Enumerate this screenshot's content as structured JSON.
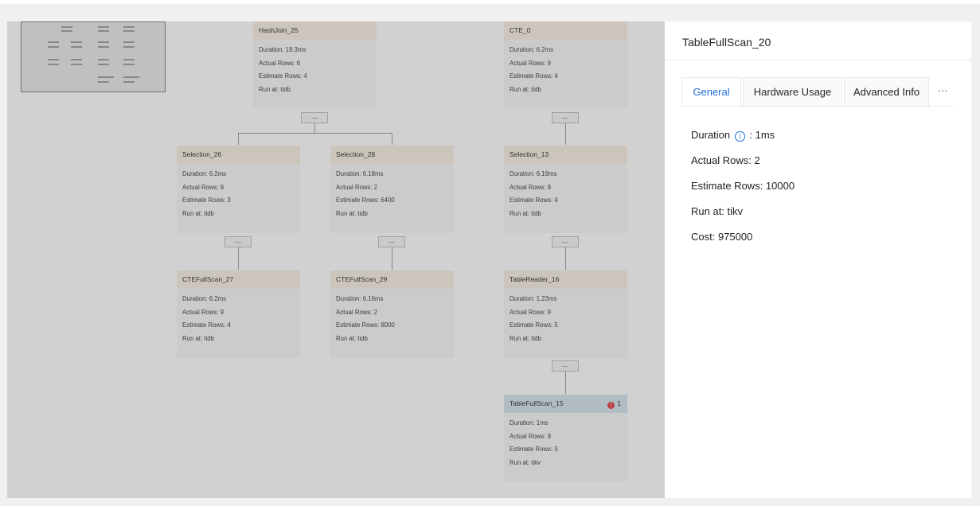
{
  "plan_nodes": [
    {
      "id": "HashJoin_25",
      "duration": "Duration: 19.3ms",
      "actual_rows": "Actual Rows: 6",
      "estimate_rows": "Estimate Rows: 4",
      "run_at": "Run at: tidb"
    },
    {
      "id": "CTE_0",
      "duration": "Duration: 6.2ms",
      "actual_rows": "Actual Rows: 9",
      "estimate_rows": "Estimate Rows: 4",
      "run_at": "Run at: tidb"
    },
    {
      "id": "Selection_26",
      "duration": "Duration: 6.2ms",
      "actual_rows": "Actual Rows: 9",
      "estimate_rows": "Estimate Rows: 3",
      "run_at": "Run at: tidb"
    },
    {
      "id": "Selection_28",
      "duration": "Duration: 6.18ms",
      "actual_rows": "Actual Rows: 2",
      "estimate_rows": "Estimate Rows: 6400",
      "run_at": "Run at: tidb"
    },
    {
      "id": "Selection_13",
      "duration": "Duration: 6.19ms",
      "actual_rows": "Actual Rows: 9",
      "estimate_rows": "Estimate Rows: 4",
      "run_at": "Run at: tidb"
    },
    {
      "id": "CTEFullScan_27",
      "duration": "Duration: 6.2ms",
      "actual_rows": "Actual Rows: 9",
      "estimate_rows": "Estimate Rows: 4",
      "run_at": "Run at: tidb"
    },
    {
      "id": "CTEFullScan_29",
      "duration": "Duration: 6.16ms",
      "actual_rows": "Actual Rows: 2",
      "estimate_rows": "Estimate Rows: 8000",
      "run_at": "Run at: tidb"
    },
    {
      "id": "TableReader_16",
      "duration": "Duration: 1.23ms",
      "actual_rows": "Actual Rows: 9",
      "estimate_rows": "Estimate Rows: 5",
      "run_at": "Run at: tidb"
    },
    {
      "id": "TableFullScan_15",
      "duration": "Duration: 1ms",
      "actual_rows": "Actual Rows: 9",
      "estimate_rows": "Estimate Rows: 5",
      "run_at": "Run at: tikv",
      "error_count": "1"
    }
  ],
  "collapse_label": "—",
  "detail_panel": {
    "title": "TableFullScan_20",
    "tabs": [
      "General",
      "Hardware Usage",
      "Advanced Info"
    ],
    "more_label": "···",
    "duration_label": "Duration",
    "duration_value": ": 1ms",
    "info_icon": "i",
    "actual_rows": "Actual Rows: 2",
    "estimate_rows": "Estimate Rows: 10000",
    "run_at": "Run at: tikv",
    "cost": "Cost: 975000"
  },
  "colors": {
    "accent": "#1f6bd6",
    "error": "#e0393e",
    "node_header": "#f9efe2",
    "selected_node_header": "#d5e3ec"
  }
}
